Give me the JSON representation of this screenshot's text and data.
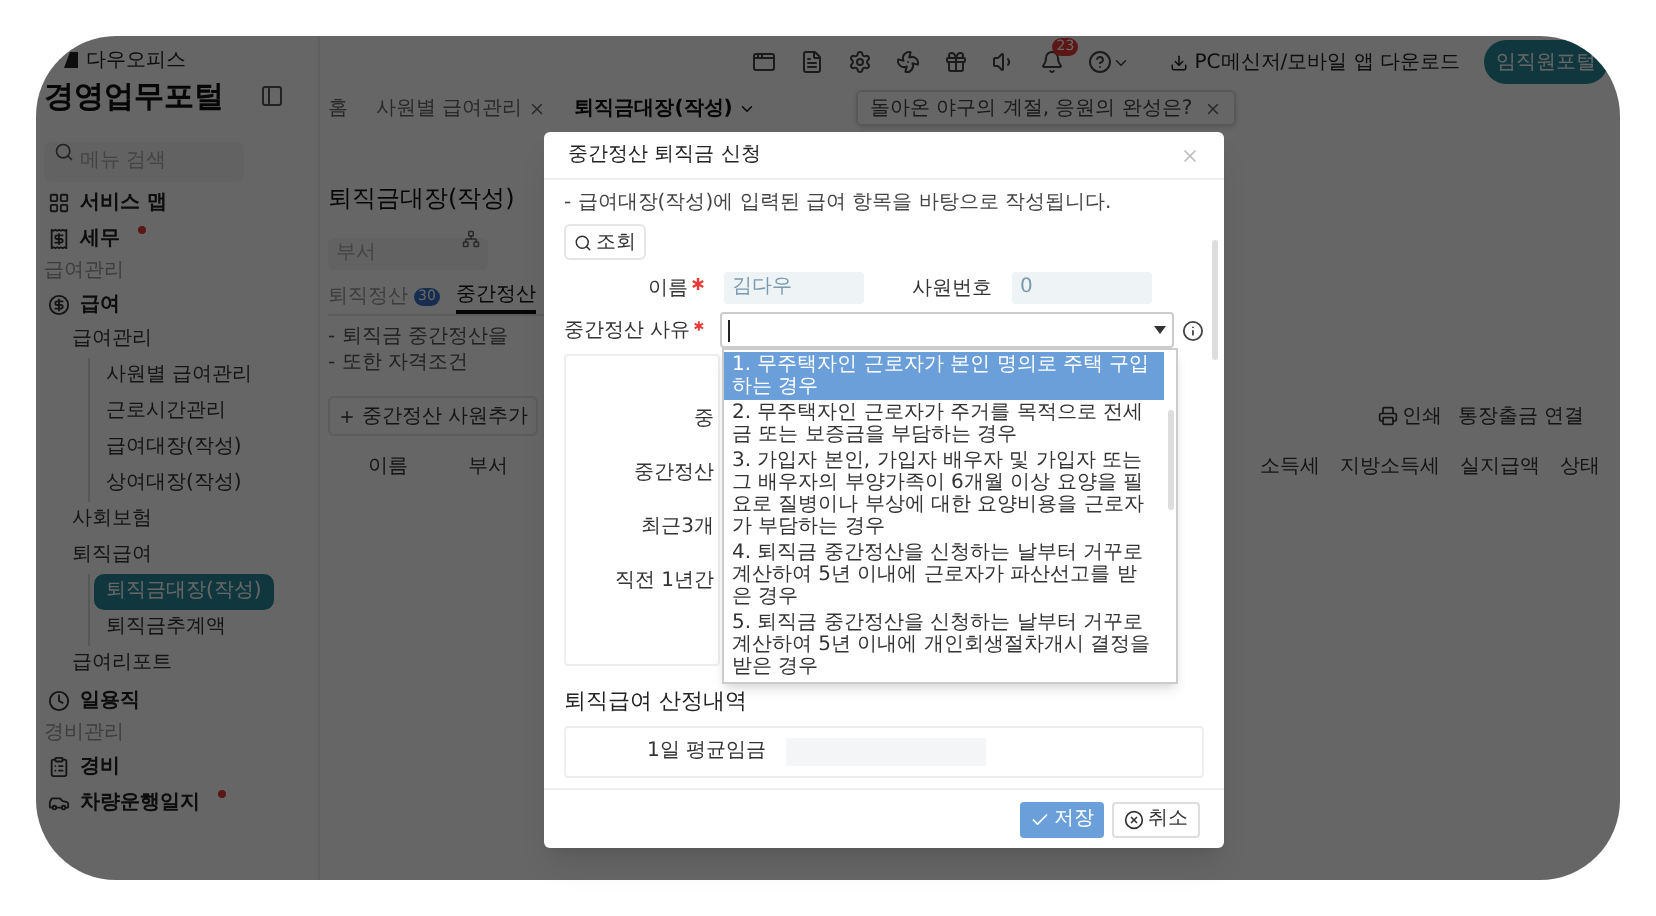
{
  "brand": {
    "name": "다우오피스",
    "portal": "경영업무포털"
  },
  "menu_search": {
    "placeholder": "메뉴 검색"
  },
  "sidebar": [
    {
      "kind": "item",
      "label": "서비스 맵",
      "dot": false
    },
    {
      "kind": "item",
      "label": "세무",
      "dot": true
    },
    {
      "kind": "section",
      "label": "급여관리"
    },
    {
      "kind": "item",
      "label": "급여",
      "dot": false,
      "children": [
        {
          "label": "급여관리",
          "selected": false,
          "children": [
            {
              "label": "사원별 급여관리",
              "selected": false
            },
            {
              "label": "근로시간관리",
              "selected": false
            },
            {
              "label": "급여대장(작성)",
              "selected": false
            },
            {
              "label": "상여대장(작성)",
              "selected": false
            }
          ]
        },
        {
          "label": "사회보험",
          "selected": false
        },
        {
          "label": "퇴직급여",
          "selected": false,
          "children": [
            {
              "label": "퇴직금대장(작성)",
              "selected": true
            },
            {
              "label": "퇴직금추계액",
              "selected": false
            }
          ]
        },
        {
          "label": "급여리포트",
          "selected": false
        }
      ]
    },
    {
      "kind": "item",
      "label": "일용직",
      "dot": false
    },
    {
      "kind": "section",
      "label": "경비관리"
    },
    {
      "kind": "item",
      "label": "경비",
      "dot": false
    },
    {
      "kind": "item",
      "label": "차량운행일지",
      "dot": true
    }
  ],
  "header": {
    "alert_count": "23",
    "download": "PC메신저/모바일 앱 다운로드",
    "portal_button": "임직원포털"
  },
  "page_tabs": [
    {
      "label": "홈",
      "closable": false,
      "selected": false
    },
    {
      "label": "사원별 급여관리",
      "closable": true,
      "selected": false
    },
    {
      "label": "퇴직금대장(작성)",
      "closable": false,
      "selected": true
    }
  ],
  "banner": {
    "text": "돌아온 야구의 계절, 응원의 완성은?"
  },
  "page": {
    "title": "퇴직금대장(작성)",
    "filter": {
      "placeholder": "부서"
    },
    "tabs": [
      {
        "label": "퇴직정산",
        "badge": "30",
        "selected": false
      },
      {
        "label": "중간정산",
        "selected": true
      }
    ],
    "notes": [
      "- 퇴직금 중간정산을",
      "- 또한 자격조건"
    ],
    "add_button": "중간정산 사원추가",
    "print_button": "인쇄",
    "bank_button": "통장출금 연결",
    "columns_left": [
      "이름",
      "부서"
    ],
    "columns_right": [
      "소득세",
      "지방소득세",
      "실지급액",
      "상태"
    ]
  },
  "modal": {
    "title": "중간정산 퇴직금 신청",
    "note": "- 급여대장(작성)에 입력된 급여 항목을 바탕으로 작성됩니다.",
    "search_button": "조회",
    "fields": [
      {
        "label": "이름",
        "required": true,
        "value": "김다우"
      },
      {
        "label": "사원번호",
        "required": false,
        "value": "0"
      }
    ],
    "reason": {
      "label": "중간정산 사유",
      "required": true,
      "options": [
        {
          "label": "1. 무주택자인 근로자가 본인 명의로 주택 구입하는 경우",
          "selected": true
        },
        {
          "label": "2. 무주택자인 근로자가 주거를 목적으로 전세금 또는 보증금을 부담하는 경우",
          "selected": false
        },
        {
          "label": "3. 가입자 본인, 가입자 배우자 및 가입자 또는 그 배우자의 부양가족이 6개월 이상 요양을 필요로 질병이나 부상에 대한 요양비용을 근로자가 부담하는 경우",
          "selected": false
        },
        {
          "label": "4. 퇴직금 중간정산을 신청하는 날부터 거꾸로 계산하여 5년 이내에 근로자가 파산선고를 받은 경우",
          "selected": false
        },
        {
          "label": "5. 퇴직금 중간정산을 신청하는 날부터 거꾸로 계산하여 5년 이내에 개인회생절차개시 결정을 받은 경우",
          "selected": false
        }
      ]
    },
    "covered_labels": [
      "중",
      "중간정산",
      "최근3개",
      "직전 1년간"
    ],
    "section_title": "퇴직급여 산정내역",
    "wage_row": {
      "label": "1일 평균임금"
    },
    "save_button": "저장",
    "cancel_button": "취소"
  }
}
